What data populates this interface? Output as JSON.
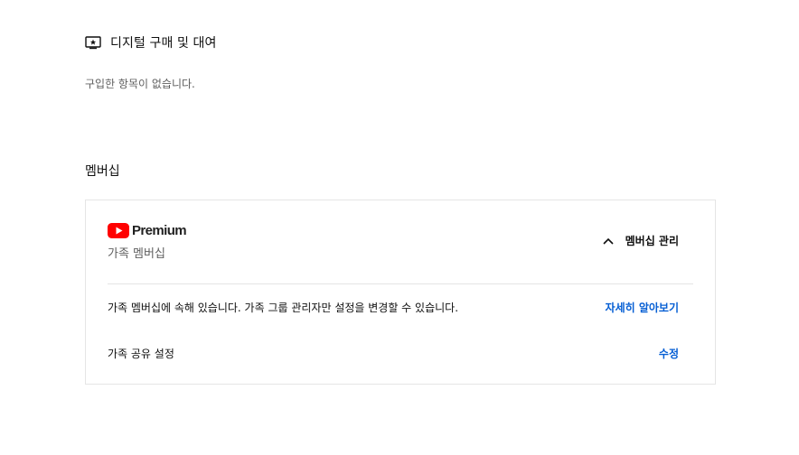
{
  "digital": {
    "icon": "movie-star-icon",
    "title": "디지털 구매 및 대여",
    "empty_text": "구입한 항목이 없습니다."
  },
  "membership": {
    "title": "멤버십",
    "card": {
      "logo_icon": "youtube-play-icon",
      "logo_text": "Premium",
      "brand_color": "#ff0000",
      "plan_name": "가족 멤버십",
      "manage_icon": "chevron-up-icon",
      "manage_label": "멤버십 관리",
      "info_text": "가족 멤버십에 속해 있습니다. 가족 그룹 관리자만 설정을 변경할 수 있습니다.",
      "learn_more_label": "자세히 알아보기",
      "sharing_label": "가족 공유 설정",
      "edit_label": "수정",
      "link_color": "#065fd4"
    }
  }
}
